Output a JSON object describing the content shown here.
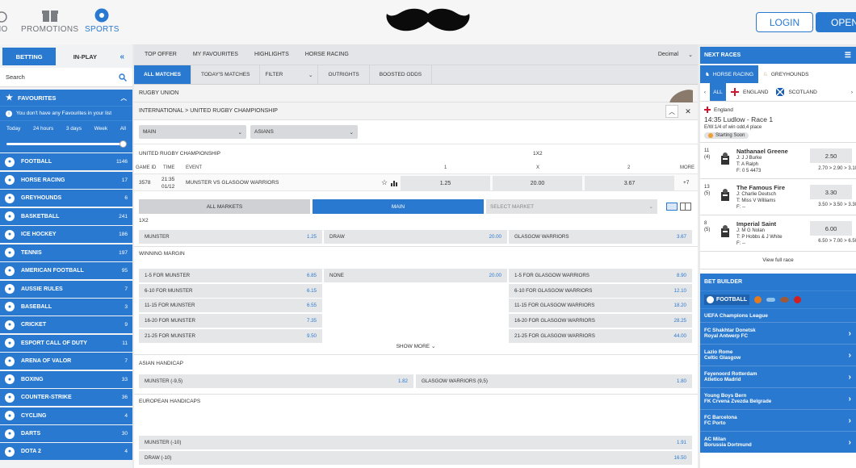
{
  "header": {
    "nav": [
      {
        "label": "NO"
      },
      {
        "label": "PROMOTIONS"
      },
      {
        "label": "SPORTS"
      }
    ],
    "login": "LOGIN",
    "open": "OPEN"
  },
  "sidebar": {
    "tab_betting": "BETTING",
    "tab_inplay": "IN-PLAY",
    "collapse": "«",
    "search_placeholder": "Search",
    "favourites": "FAVOURITES",
    "fav_info": "You don't have any Favourites in your list",
    "time_filters": [
      "Today",
      "24 hours",
      "3 days",
      "Week",
      "All"
    ],
    "sports": [
      {
        "name": "FOOTBALL",
        "count": "1146"
      },
      {
        "name": "HORSE RACING",
        "count": "17"
      },
      {
        "name": "GREYHOUNDS",
        "count": "6"
      },
      {
        "name": "BASKETBALL",
        "count": "241"
      },
      {
        "name": "ICE HOCKEY",
        "count": "186"
      },
      {
        "name": "TENNIS",
        "count": "197"
      },
      {
        "name": "AMERICAN FOOTBALL",
        "count": "95"
      },
      {
        "name": "AUSSIE RULES",
        "count": "7"
      },
      {
        "name": "BASEBALL",
        "count": "3"
      },
      {
        "name": "CRICKET",
        "count": "9"
      },
      {
        "name": "ESPORT CALL OF DUTY",
        "count": "11"
      },
      {
        "name": "ARENA OF VALOR",
        "count": "7"
      },
      {
        "name": "BOXING",
        "count": "33"
      },
      {
        "name": "COUNTER-STRIKE",
        "count": "36"
      },
      {
        "name": "CYCLING",
        "count": "4"
      },
      {
        "name": "DARTS",
        "count": "30"
      },
      {
        "name": "DOTA 2",
        "count": "4"
      }
    ]
  },
  "main": {
    "nav": [
      "TOP OFFER",
      "MY FAVOURITES",
      "HIGHLIGHTS",
      "HORSE RACING"
    ],
    "odds_format": "Decimal",
    "subnav": [
      "ALL MATCHES",
      "TODAY'S MATCHES",
      "FILTER",
      "OUTRIGHTS",
      "BOOSTED ODDS"
    ],
    "sport_title": "RUGBY UNION",
    "breadcrumb": "INTERNATIONAL > UNITED RUGBY CHAMPIONSHIP",
    "select_main": "MAIN",
    "select_asians": "ASIANS",
    "competition": "UNITED RUGBY CHAMPIONSHIP",
    "market_label": "1X2",
    "cols": {
      "game_id": "GAME ID",
      "time": "TIME",
      "event": "EVENT",
      "c1": "1",
      "cx": "X",
      "c2": "2",
      "more": "MORE"
    },
    "match": {
      "id": "3578",
      "time": "21:35",
      "date": "01/12",
      "event": "MUNSTER VS GLASGOW WARRIORS",
      "o1": "1.25",
      "ox": "20.00",
      "o2": "3.67",
      "more": "+7"
    },
    "tabs": {
      "all": "ALL MARKETS",
      "main": "MAIN",
      "select": "SELECT MARKET"
    },
    "m1x2": {
      "title": "1X2",
      "home": "MUNSTER",
      "home_o": "1.25",
      "draw": "DRAW",
      "draw_o": "20.00",
      "away": "GLASGOW WARRIORS",
      "away_o": "3.67"
    },
    "winning_margin": {
      "title": "WINNING MARGIN",
      "left": [
        {
          "l": "1-5 FOR MUNSTER",
          "o": "6.85"
        },
        {
          "l": "6-10 FOR MUNSTER",
          "o": "6.15"
        },
        {
          "l": "11-15 FOR MUNSTER",
          "o": "6.55"
        },
        {
          "l": "16-20 FOR MUNSTER",
          "o": "7.35"
        },
        {
          "l": "21-25 FOR MUNSTER",
          "o": "9.50"
        }
      ],
      "none": {
        "l": "NONE",
        "o": "20.00"
      },
      "right": [
        {
          "l": "1-5 FOR GLASGOW WARRIORS",
          "o": "8.90"
        },
        {
          "l": "6-10 FOR GLASGOW WARRIORS",
          "o": "12.10"
        },
        {
          "l": "11-15 FOR GLASGOW WARRIORS",
          "o": "18.20"
        },
        {
          "l": "16-20 FOR GLASGOW WARRIORS",
          "o": "28.25"
        },
        {
          "l": "21-25 FOR GLASGOW WARRIORS",
          "o": "44.00"
        }
      ],
      "show_more": "SHOW MORE"
    },
    "asian": {
      "title": "ASIAN HANDICAP",
      "home": "MUNSTER (-9,5)",
      "home_o": "1.82",
      "away": "GLASGOW WARRIORS (9,5)",
      "away_o": "1.80"
    },
    "euro": {
      "title": "EUROPEAN HANDICAPS",
      "r1": "MUNSTER (-10)",
      "r1_o": "1.91",
      "r2": "DRAW (-10)",
      "r2_o": "16.50"
    }
  },
  "right": {
    "next_races": "NEXT RACES",
    "tab_horse": "HORSE RACING",
    "tab_grey": "GREYHOUNDS",
    "flags": {
      "all": "ALL",
      "england": "ENGLAND",
      "scotland": "SCOTLAND"
    },
    "race": {
      "country": "England",
      "title": "14:35 Ludlow - Race 1",
      "terms": "E/W:1/4 of win odd,4 place",
      "status": "Starting Soon"
    },
    "runners": [
      {
        "no": "11",
        "draw": "(4)",
        "name": "Nathanael Greene",
        "j": "J: J J Burke",
        "t": "T: A Ralph",
        "f": "F: 0 5 4473",
        "odd": "2.50",
        "prev": "2.70 > 2.90 > 3.10"
      },
      {
        "no": "13",
        "draw": "(5)",
        "name": "The Famous Fire",
        "j": "J: Charlie Deutsch",
        "t": "T: Miss V Williams",
        "f": "F: --",
        "odd": "3.30",
        "prev": "3.50 > 3.50 > 3.30"
      },
      {
        "no": "8",
        "draw": "(5)",
        "name": "Imperial Saint",
        "j": "J: M G Nolan",
        "t": "T: P Hobbs & J White",
        "f": "F: --",
        "odd": "6.00",
        "prev": "6.50 > 7.00 > 6.50"
      }
    ],
    "view_full": "View full race",
    "bet_builder": "BET BUILDER",
    "bb_sport": "FOOTBALL",
    "league": "UEFA Champions League",
    "matches": [
      {
        "home": "FC Shakhtar Donetsk",
        "away": "Royal Antwerp FC"
      },
      {
        "home": "Lazio Rome",
        "away": "Celtic Glasgow"
      },
      {
        "home": "Feyenoord Rotterdam",
        "away": "Atletico Madrid"
      },
      {
        "home": "Young Boys Bern",
        "away": "FK Crvena Zvezda Belgrade"
      },
      {
        "home": "FC Barcelona",
        "away": "FC Porto"
      },
      {
        "home": "AC Milan",
        "away": "Borussia Dortmund"
      }
    ]
  }
}
